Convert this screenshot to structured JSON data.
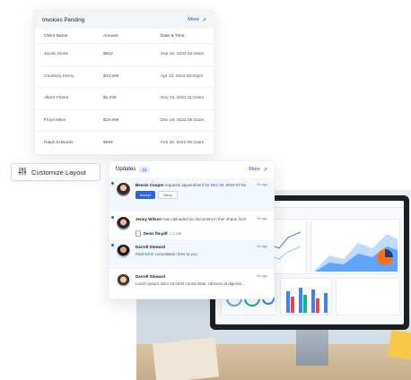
{
  "invoices": {
    "title": "Invoices Pending",
    "more": "More",
    "columns": [
      "Client Name",
      "Amount",
      "Date & Time"
    ],
    "rows": [
      [
        "Jacob Jones",
        "$819",
        "Sep 10, 2022 04:45am"
      ],
      [
        "Courtney Henry",
        "$43,599",
        "Apr 12, 2022 05:02pm"
      ],
      [
        "Albert Flores",
        "$1,039",
        "Nov 23, 2022 11:23am"
      ],
      [
        "Floyd Miles",
        "$19,999",
        "Dec 19, 2022 09:22am"
      ],
      [
        "Ralph Edwards",
        "$699",
        "Feb 20, 2022 06:22am"
      ]
    ]
  },
  "customize": {
    "label": "Customize Layout",
    "icon": "sliders-icon"
  },
  "updates": {
    "title": "Updates",
    "count": "12",
    "more": "More",
    "items": [
      {
        "name": "Bessie Cooper",
        "text": "requests appointment for",
        "highlight": "Dec 30, 2019 07:52",
        "time": "2h ago",
        "accept": "Accept",
        "deny": "Deny"
      },
      {
        "name": "Jenny Wilson",
        "text": "Has Uploaded an document in ther shane form",
        "time": "3h ago",
        "file_name": "Demo file.pdf",
        "file_size": "2.2 MB"
      },
      {
        "name": "Darrell Steward",
        "text_before": "Paid",
        "amount": "$200",
        "text_after": "consultation fees to you",
        "time": "3h ago"
      },
      {
        "name": "Darrell Steward",
        "text": "Lorem ipsum dolor sit amet consectetur. Ultricies at dignissi...",
        "time": "5h ago"
      }
    ]
  },
  "colors": {
    "accent": "#2563eb",
    "success": "#16a34a"
  }
}
